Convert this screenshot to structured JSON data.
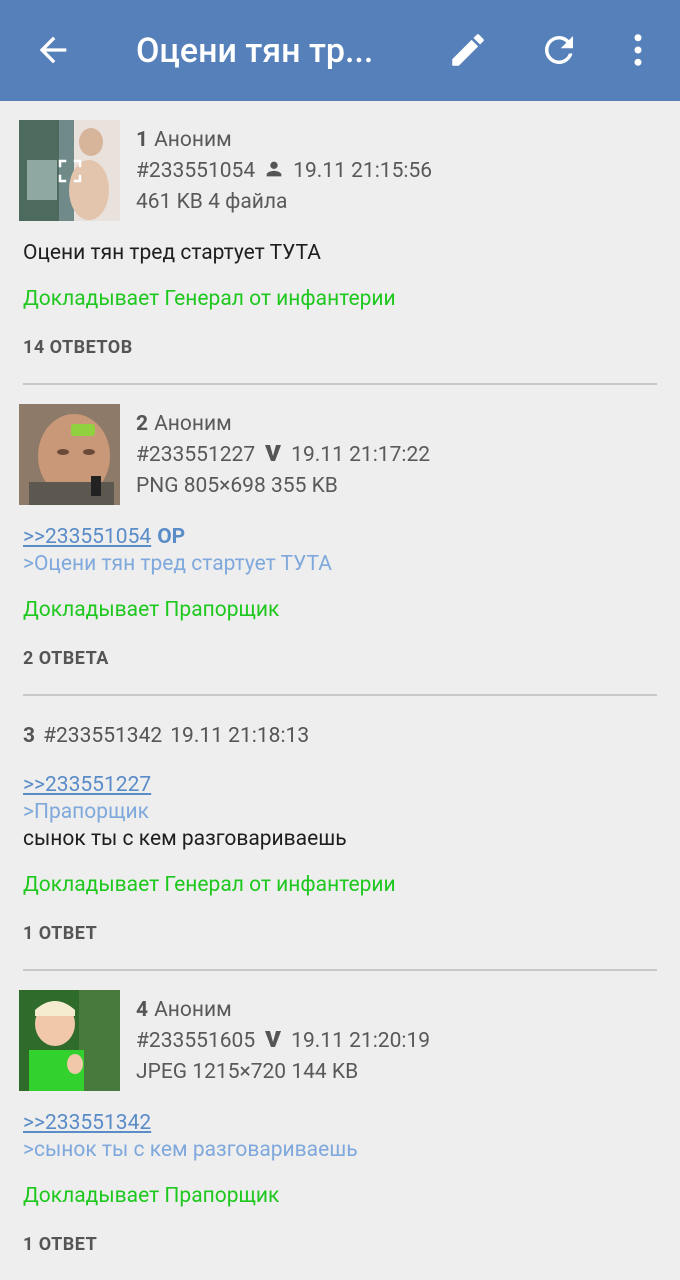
{
  "toolbar": {
    "title": "Оцени тян тр...",
    "icons": [
      "arrow-back-icon",
      "edit-icon",
      "refresh-icon",
      "more-vert-icon"
    ],
    "bg_color": "#5680b9"
  },
  "posts": [
    {
      "index": "1",
      "name": "Аноним",
      "id": "#233551054",
      "badge_icon": "person-icon",
      "time": "19.11 21:15:56",
      "file_info": "461 KB 4 файла",
      "thumb_icon": "fullscreen-icon",
      "text": "Оцени тян тред стартует ТУТА",
      "sig": "Докладывает Генерал от инфантерии",
      "replies": "14 ОТВЕТОВ"
    },
    {
      "index": "2",
      "name": "Аноним",
      "id": "#233551227",
      "badge_icon": "v-icon",
      "time": "19.11 21:17:22",
      "file_info": "PNG 805×698 355 KB",
      "reply_to": ">>233551054",
      "op_label": "OP",
      "quote": ">Оцени тян тред стартует ТУТА",
      "sig": "Докладывает Прапорщик",
      "replies": "2 ОТВЕТА"
    },
    {
      "index": "3",
      "id": "#233551342",
      "time": "19.11 21:18:13",
      "reply_to": ">>233551227",
      "quote": ">Прапорщик",
      "text": "сынок ты с кем разговариваешь",
      "sig": "Докладывает Генерал от инфантерии",
      "replies": "1 ОТВЕТ"
    },
    {
      "index": "4",
      "name": "Аноним",
      "id": "#233551605",
      "badge_icon": "v-icon",
      "time": "19.11 21:20:19",
      "file_info": "JPEG 1215×720 144 KB",
      "reply_to": ">>233551342",
      "quote": ">сынок ты с кем разговариваешь",
      "sig": "Докладывает Прапорщик",
      "replies": "1 ОТВЕТ"
    }
  ]
}
